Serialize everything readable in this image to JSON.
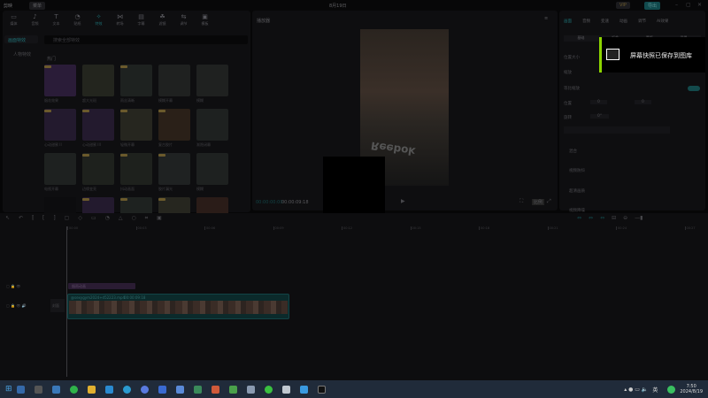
{
  "app": {
    "name": "剪映",
    "menu": "菜单",
    "project_title": "8月19日",
    "vip_label": "VIP",
    "export_label": "导出"
  },
  "media_tabs": [
    {
      "label": "媒体",
      "icon": "media-icon"
    },
    {
      "label": "音频",
      "icon": "audio-icon"
    },
    {
      "label": "文本",
      "icon": "text-icon"
    },
    {
      "label": "贴纸",
      "icon": "sticker-icon"
    },
    {
      "label": "特效",
      "icon": "effects-icon",
      "active": true
    },
    {
      "label": "转场",
      "icon": "transition-icon"
    },
    {
      "label": "字幕",
      "icon": "caption-icon"
    },
    {
      "label": "滤镜",
      "icon": "filter-icon"
    },
    {
      "label": "调节",
      "icon": "adjust-icon"
    },
    {
      "label": "模板",
      "icon": "template-icon"
    }
  ],
  "sidebar": {
    "items": [
      "画面特效",
      "人物特效"
    ]
  },
  "search": {
    "placeholder": "搜索全部特效"
  },
  "section_title": "热门",
  "effects": [
    {
      "name": "烟花效果",
      "vip": true,
      "color": "#2a1c38"
    },
    {
      "name": "超大光斑",
      "vip": false,
      "color": "#23251e"
    },
    {
      "name": "雨丝清晰",
      "vip": true,
      "color": "#1e2220"
    },
    {
      "name": "模糊开幕",
      "vip": false,
      "color": "#1f2120"
    },
    {
      "name": "模糊",
      "vip": false,
      "color": "#1f2120"
    },
    {
      "name": "心动甜蜜 II",
      "vip": true,
      "color": "#231a2e"
    },
    {
      "name": "心动甜蜜 III",
      "vip": true,
      "color": "#231a2e"
    },
    {
      "name": "轻微开幕",
      "vip": true,
      "color": "#26261f"
    },
    {
      "name": "复古胶片",
      "vip": true,
      "color": "#2a2018"
    },
    {
      "name": "渐隐闭幕",
      "vip": false,
      "color": "#1e2120"
    },
    {
      "name": "电视开幕",
      "vip": false,
      "color": "#1e2120"
    },
    {
      "name": "边缘变亮",
      "vip": true,
      "color": "#1e211d"
    },
    {
      "name": "抖动画面",
      "vip": true,
      "color": "#1e211d"
    },
    {
      "name": "胶片漏光",
      "vip": true,
      "color": "#1f2222"
    },
    {
      "name": "模糊",
      "vip": false,
      "color": "#1e2120"
    },
    {
      "name": "",
      "vip": false,
      "color": "#0c0c0e"
    },
    {
      "name": "",
      "vip": true,
      "color": "#231a2e"
    },
    {
      "name": "",
      "vip": true,
      "color": "#1e2220"
    },
    {
      "name": "",
      "vip": true,
      "color": "#26261f"
    },
    {
      "name": "",
      "vip": false,
      "color": "#2a1c18"
    }
  ],
  "player": {
    "title": "播放器",
    "current_time": "00:00:00:00",
    "total_time": "00:00:09:18",
    "ratio_label": "比例",
    "overlay_text": "Reebok"
  },
  "inspector": {
    "tabs": [
      "画面",
      "音频",
      "变速",
      "动画",
      "调节",
      "AI效果"
    ],
    "subtabs": [
      "基础",
      "抠像",
      "蒙版",
      "背景"
    ],
    "position_size": "位置大小",
    "scale": "缩放",
    "scale_value": "100%",
    "uniform_scale": "等比缩放",
    "position": "位置",
    "x": "0",
    "y": "0",
    "rotation": "旋转",
    "rotation_value": "0°",
    "blend": "混合",
    "stabilize": "视频防抖",
    "enhance": "超清画质",
    "denoise": "视频降噪"
  },
  "toast": {
    "message": "屏幕快照已保存到图库",
    "accent": "#8cd400"
  },
  "timeline": {
    "ticks": [
      "00:00",
      "00:03",
      "00:06",
      "00:09",
      "00:12",
      "00:15",
      "00:18",
      "00:21",
      "00:24",
      "00:27"
    ],
    "effect_clip": "烟雨动画",
    "video_clip": {
      "filename": "@sexygym2024+d52223.mp4",
      "duration": "00:00:09:18"
    },
    "cover_label": "封面"
  },
  "taskbar": {
    "time": "7:50",
    "date": "2024/8/19",
    "lang": "英"
  }
}
